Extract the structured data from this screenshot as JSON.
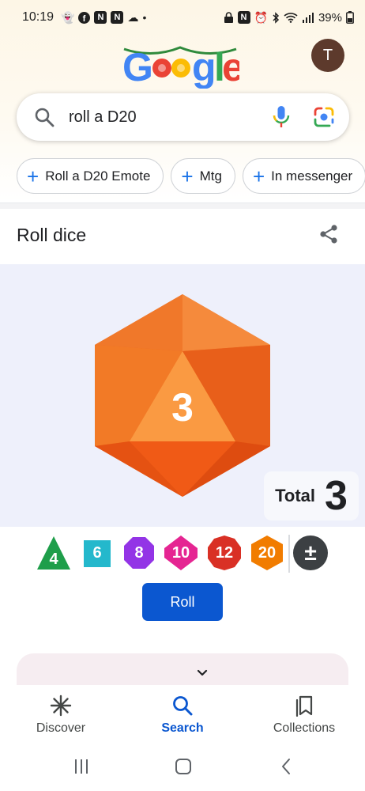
{
  "status_bar": {
    "time": "10:19",
    "battery": "39%",
    "left_icons": [
      "snapchat-icon",
      "facebook-icon",
      "app-n-icon",
      "app-n-icon",
      "cloud-icon",
      "dot-icon"
    ],
    "right_icons": [
      "lock-icon",
      "nfc-icon",
      "alarm-icon",
      "bluetooth-icon",
      "wifi-icon",
      "signal-icon",
      "battery-icon"
    ]
  },
  "header": {
    "logo_text": "Google",
    "avatar_initial": "T"
  },
  "search": {
    "query": "roll a D20"
  },
  "chips": [
    {
      "label": "Roll a D20 Emote"
    },
    {
      "label": "Mtg"
    },
    {
      "label": "In messenger"
    }
  ],
  "card": {
    "title": "Roll dice",
    "die_face_value": "3",
    "total_label": "Total",
    "total_value": "3",
    "roll_label": "Roll"
  },
  "dice_options": [
    {
      "label": "4",
      "shape": "triangle",
      "color": "#1e9e4a"
    },
    {
      "label": "6",
      "shape": "square",
      "color": "#24b8cc"
    },
    {
      "label": "8",
      "shape": "octagon",
      "color": "#9334e6"
    },
    {
      "label": "10",
      "shape": "diamond",
      "color": "#e52592"
    },
    {
      "label": "12",
      "shape": "dodecagon",
      "color": "#d93025"
    },
    {
      "label": "20",
      "shape": "hexagon",
      "color": "#f17c00"
    }
  ],
  "modifier_label": "±",
  "bottom_nav": [
    {
      "label": "Discover",
      "icon": "asterisk-icon",
      "active": false
    },
    {
      "label": "Search",
      "icon": "search-icon",
      "active": true
    },
    {
      "label": "Collections",
      "icon": "bookmarks-icon",
      "active": false
    }
  ],
  "colors": {
    "accent": "#0b57d0",
    "die_primary": "#f26b1d",
    "stage_bg": "#eef0fb"
  }
}
